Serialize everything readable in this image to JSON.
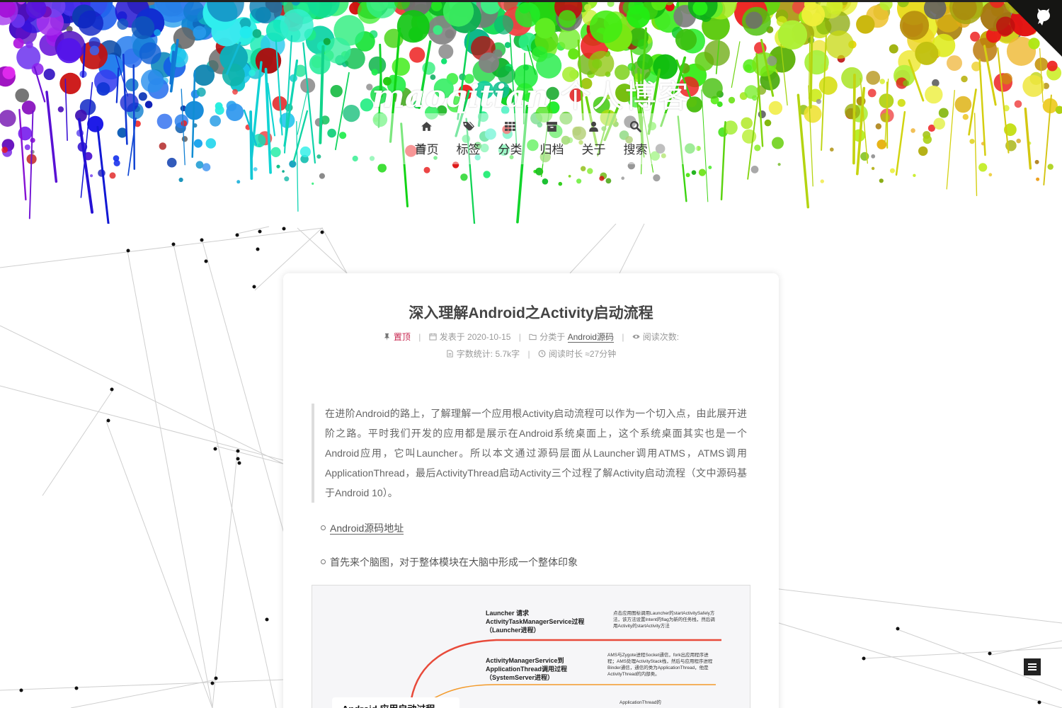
{
  "site": {
    "title_latin": "maoqitian",
    "title_cn": " 个人博客"
  },
  "nav": [
    {
      "label": "首页",
      "icon": "home-icon"
    },
    {
      "label": "标签",
      "icon": "tags-icon"
    },
    {
      "label": "分类",
      "icon": "th-icon"
    },
    {
      "label": "归档",
      "icon": "archive-icon"
    },
    {
      "label": "关于",
      "icon": "user-icon"
    },
    {
      "label": "搜索",
      "icon": "search-icon"
    }
  ],
  "post": {
    "title": "深入理解Android之Activity启动流程",
    "pinned": "置顶",
    "posted_prefix": "发表于",
    "posted_date": "2020-10-15",
    "category_prefix": "分类于",
    "category": "Android源码",
    "views_label": "阅读次数:",
    "wordcount_label": "字数统计:",
    "wordcount": "5.7k字",
    "readtime_label": "阅读时长",
    "readtime": "≈27分钟",
    "quote": "在进阶Android的路上，了解理解一个应用根Activity启动流程可以作为一个切入点，由此展开进阶之路。平时我们开发的应用都是展示在Android系统桌面上，这个系统桌面其实也是一个Android应用，它叫Launcher。所以本文通过源码层面从Launcher调用ATMS，ATMS调用ApplicationThread，最后ActivityThread启动Activity三个过程了解Activity启动流程（文中源码基于Android 10）。",
    "bullet_link": "Android源码地址",
    "bullet_text": "首先来个脑图，对于整体模块在大脑中形成一个整体印象"
  },
  "mindmap": {
    "root": "Android 应用启动过程",
    "branch1": "Launcher 请求 ActivityTaskManagerService过程（Launcher进程）",
    "note1": "点击应用图标调用Launcher的startActivitySafely方法，该方法设置Intent的flag为新的任务栈，然后调用Activity的startActivity方法",
    "branch2": "ActivityManagerService到ApplicationThread调用过程（SystemServer进程）",
    "note2": "AMS与Zygote进程Socket通信，fork出应用程序进程；AMS处理ActivityStack栈，然后与应用程序进程Binder通信，通信的类为ApplicationThread，他是ActivityThread的内部类。",
    "note3": "ApplicationThread的"
  },
  "colors": {
    "accent_pinned": "#c7254e",
    "topline": "#222222",
    "branch1": "#e84a3a",
    "branch2": "#f39a2a"
  },
  "icons": {
    "github": "github-octocat-icon",
    "toc": "menu-icon",
    "meta": [
      "pin-icon",
      "calendar-icon",
      "folder-icon",
      "eye-icon",
      "file-icon",
      "clock-icon"
    ]
  }
}
